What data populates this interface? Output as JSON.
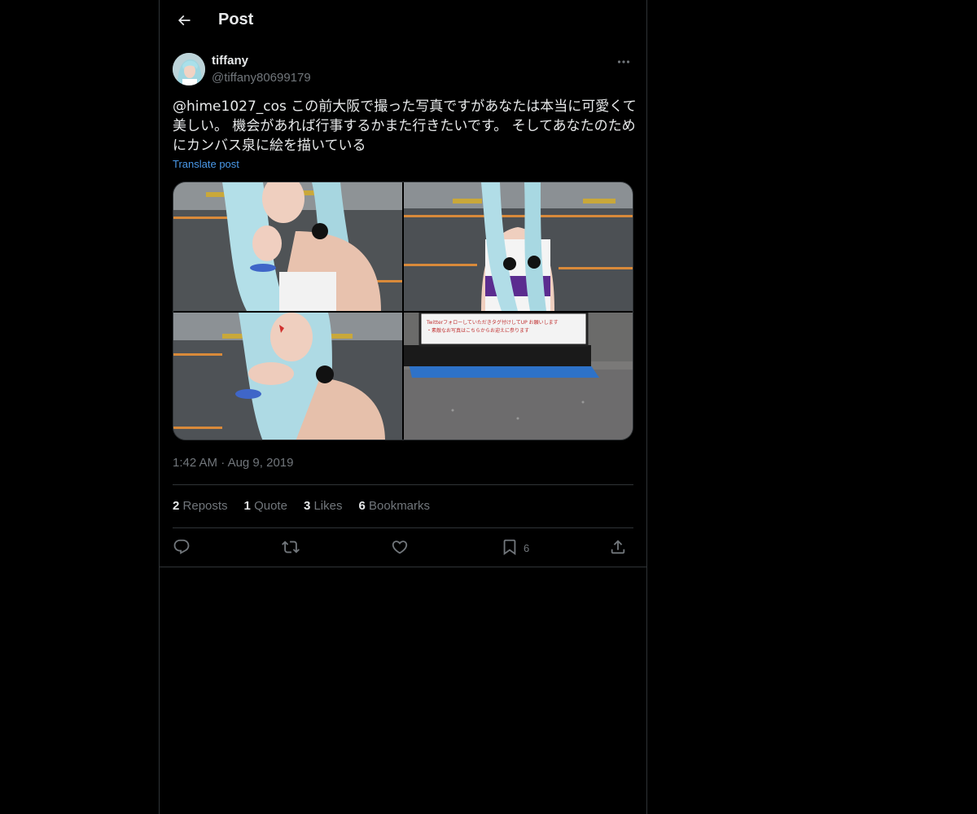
{
  "header": {
    "title": "Post",
    "back_icon": "arrow-left-icon"
  },
  "author": {
    "display_name": "tiffany",
    "handle": "@tiffany80699179",
    "avatar_icon": "avatar-image"
  },
  "post": {
    "mention": "@hime1027_cos",
    "text": " この前大阪で撮った写真ですがあなたは本当に可愛くて美しい。 機会があれば行事するかまた行きたいです。 そしてあなたのためにカンバス泉に絵を描いている",
    "translate_label": "Translate post"
  },
  "media": {
    "photos": [
      {
        "name": "cosplay-photo-1"
      },
      {
        "name": "cosplay-photo-2"
      },
      {
        "name": "cosplay-photo-3"
      },
      {
        "name": "cosplay-photo-4"
      }
    ],
    "sign_lines": [
      "Twitterフォローしていただきタグ付けしてUP お願いします",
      "・素敵なお写真はこちらからお迎えに参ります"
    ]
  },
  "meta": {
    "time": "1:42 AM",
    "separator": "·",
    "date": "Aug 9, 2019"
  },
  "stats": {
    "reposts_count": "2",
    "reposts_label": "Reposts",
    "quote_count": "1",
    "quote_label": "Quote",
    "likes_count": "3",
    "likes_label": "Likes",
    "bookmarks_count": "6",
    "bookmarks_label": "Bookmarks"
  },
  "actions": {
    "bookmark_count": "6"
  },
  "colors": {
    "background": "#000000",
    "text": "#e7e9ea",
    "secondary": "#71767b",
    "accent_link": "#4a99e9",
    "border": "#2f3336"
  }
}
